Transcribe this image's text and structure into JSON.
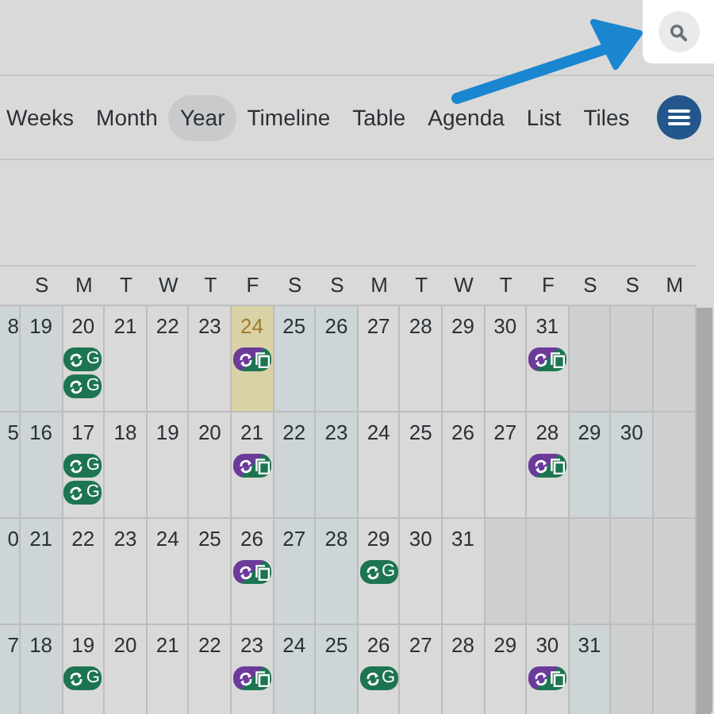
{
  "views": [
    {
      "label": "Weeks",
      "selected": false
    },
    {
      "label": "Month",
      "selected": false
    },
    {
      "label": "Year",
      "selected": true
    },
    {
      "label": "Timeline",
      "selected": false
    },
    {
      "label": "Table",
      "selected": false
    },
    {
      "label": "Agenda",
      "selected": false
    },
    {
      "label": "List",
      "selected": false
    },
    {
      "label": "Tiles",
      "selected": false
    }
  ],
  "weekdays": [
    "S",
    "M",
    "T",
    "W",
    "T",
    "F",
    "S",
    "S",
    "M",
    "T",
    "W",
    "T",
    "F",
    "S",
    "S",
    "M"
  ],
  "weeks": [
    {
      "days": [
        {
          "day": "8",
          "kind": "weekend"
        },
        {
          "day": "19",
          "kind": "weekend"
        },
        {
          "day": "20",
          "kind": "weekday",
          "events": [
            {
              "kind": "sync",
              "label": "G"
            },
            {
              "kind": "sync",
              "label": "G"
            }
          ]
        },
        {
          "day": "21",
          "kind": "weekday"
        },
        {
          "day": "22",
          "kind": "weekday"
        },
        {
          "day": "23",
          "kind": "weekday"
        },
        {
          "day": "24",
          "kind": "today",
          "events": [
            {
              "kind": "copy"
            }
          ]
        },
        {
          "day": "25",
          "kind": "weekend"
        },
        {
          "day": "26",
          "kind": "weekend"
        },
        {
          "day": "27",
          "kind": "weekday"
        },
        {
          "day": "28",
          "kind": "weekday"
        },
        {
          "day": "29",
          "kind": "weekday"
        },
        {
          "day": "30",
          "kind": "weekday"
        },
        {
          "day": "31",
          "kind": "weekday",
          "events": [
            {
              "kind": "copy"
            }
          ]
        },
        {
          "kind": "blank"
        },
        {
          "kind": "blank"
        },
        {
          "kind": "blank"
        }
      ]
    },
    {
      "days": [
        {
          "day": "5",
          "kind": "weekend"
        },
        {
          "day": "16",
          "kind": "weekend"
        },
        {
          "day": "17",
          "kind": "weekday",
          "events": [
            {
              "kind": "sync",
              "label": "G"
            },
            {
              "kind": "sync",
              "label": "G"
            }
          ]
        },
        {
          "day": "18",
          "kind": "weekday"
        },
        {
          "day": "19",
          "kind": "weekday"
        },
        {
          "day": "20",
          "kind": "weekday"
        },
        {
          "day": "21",
          "kind": "weekday",
          "events": [
            {
              "kind": "copy"
            }
          ]
        },
        {
          "day": "22",
          "kind": "weekend"
        },
        {
          "day": "23",
          "kind": "weekend"
        },
        {
          "day": "24",
          "kind": "weekday"
        },
        {
          "day": "25",
          "kind": "weekday"
        },
        {
          "day": "26",
          "kind": "weekday"
        },
        {
          "day": "27",
          "kind": "weekday"
        },
        {
          "day": "28",
          "kind": "weekday",
          "events": [
            {
              "kind": "copy"
            }
          ]
        },
        {
          "day": "29",
          "kind": "weekend"
        },
        {
          "day": "30",
          "kind": "weekend"
        },
        {
          "kind": "blank"
        }
      ]
    },
    {
      "days": [
        {
          "day": "0",
          "kind": "weekend"
        },
        {
          "day": "21",
          "kind": "weekend"
        },
        {
          "day": "22",
          "kind": "weekday"
        },
        {
          "day": "23",
          "kind": "weekday"
        },
        {
          "day": "24",
          "kind": "weekday"
        },
        {
          "day": "25",
          "kind": "weekday"
        },
        {
          "day": "26",
          "kind": "weekday",
          "events": [
            {
              "kind": "copy"
            }
          ]
        },
        {
          "day": "27",
          "kind": "weekend"
        },
        {
          "day": "28",
          "kind": "weekend"
        },
        {
          "day": "29",
          "kind": "weekday",
          "events": [
            {
              "kind": "sync",
              "label": "G"
            }
          ]
        },
        {
          "day": "30",
          "kind": "weekday"
        },
        {
          "day": "31",
          "kind": "weekday"
        },
        {
          "kind": "blank"
        },
        {
          "kind": "blank"
        },
        {
          "kind": "blank"
        },
        {
          "kind": "blank"
        },
        {
          "kind": "blank"
        }
      ]
    },
    {
      "days": [
        {
          "day": "7",
          "kind": "weekend"
        },
        {
          "day": "18",
          "kind": "weekend"
        },
        {
          "day": "19",
          "kind": "weekday",
          "events": [
            {
              "kind": "sync",
              "label": "G"
            }
          ]
        },
        {
          "day": "20",
          "kind": "weekday"
        },
        {
          "day": "21",
          "kind": "weekday"
        },
        {
          "day": "22",
          "kind": "weekday"
        },
        {
          "day": "23",
          "kind": "weekday",
          "events": [
            {
              "kind": "copy"
            }
          ]
        },
        {
          "day": "24",
          "kind": "weekend"
        },
        {
          "day": "25",
          "kind": "weekend"
        },
        {
          "day": "26",
          "kind": "weekday",
          "events": [
            {
              "kind": "sync",
              "label": "G"
            }
          ]
        },
        {
          "day": "27",
          "kind": "weekday"
        },
        {
          "day": "28",
          "kind": "weekday"
        },
        {
          "day": "29",
          "kind": "weekday"
        },
        {
          "day": "30",
          "kind": "weekday",
          "events": [
            {
              "kind": "copy"
            }
          ]
        },
        {
          "day": "31",
          "kind": "weekend"
        },
        {
          "kind": "blank"
        },
        {
          "kind": "blank"
        }
      ]
    }
  ]
}
